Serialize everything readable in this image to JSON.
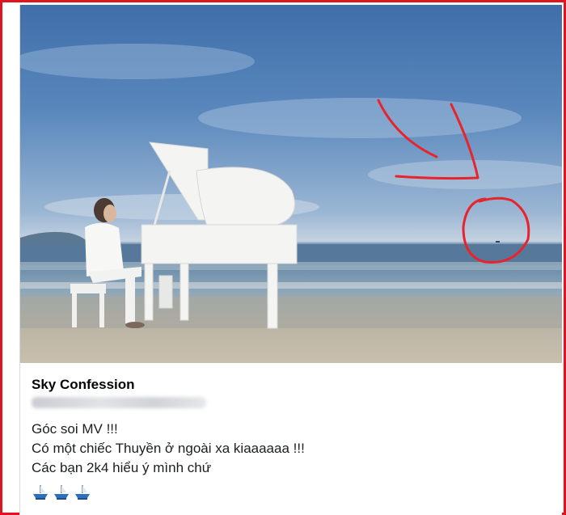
{
  "post": {
    "page_name": "Sky Confession",
    "lines": [
      "Góc soi MV !!!",
      "Có một chiếc Thuyền ở ngoài xa kiaaaaaa !!!",
      "Các bạn 2k4 hiểu ý mình chứ"
    ],
    "emojis": [
      "boat-icon",
      "boat-icon",
      "boat-icon"
    ]
  },
  "colors": {
    "highlight_frame": "#e0141e",
    "annotation_red": "#e8232b",
    "sky_top": "#3f6ea9",
    "sea": "#6b8daa",
    "sand": "#c9bfad"
  }
}
